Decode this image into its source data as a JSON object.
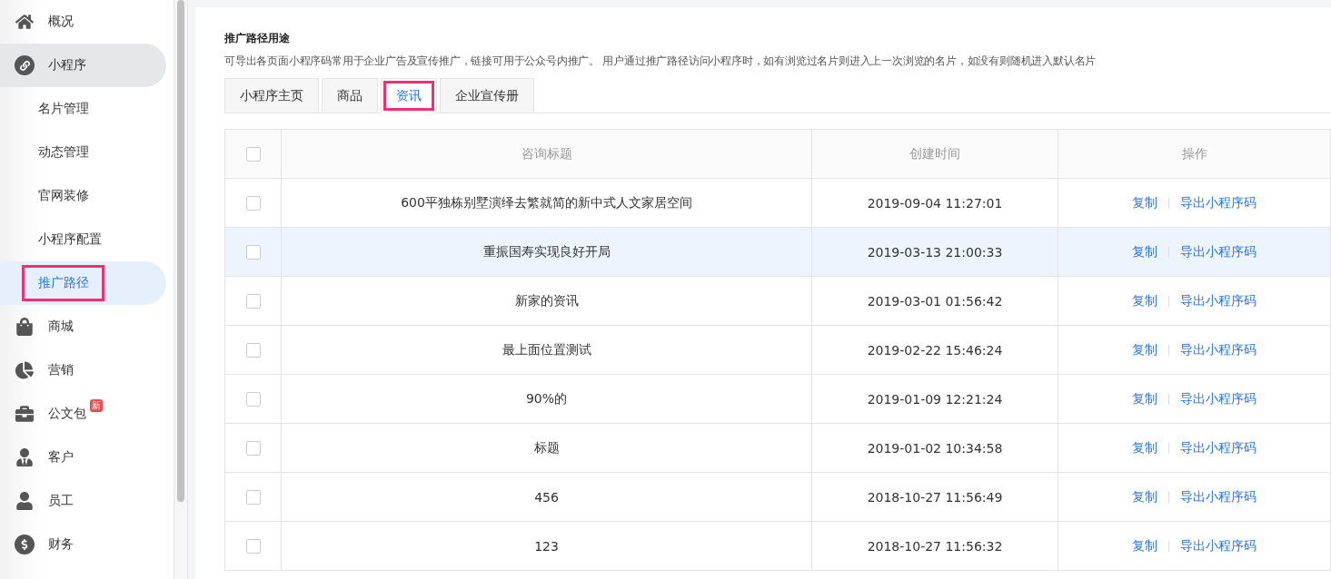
{
  "sidebar": {
    "items": [
      {
        "label": "概况",
        "kind": "home",
        "expanded": false,
        "selected": false,
        "highlighted": false
      },
      {
        "label": "小程序",
        "kind": "mini",
        "expanded": true,
        "selected": false,
        "highlighted": false,
        "children": [
          {
            "label": "名片管理",
            "selected": false,
            "highlighted": false
          },
          {
            "label": "动态管理",
            "selected": false,
            "highlighted": false
          },
          {
            "label": "官网装修",
            "selected": false,
            "highlighted": false
          },
          {
            "label": "小程序配置",
            "selected": false,
            "highlighted": false
          },
          {
            "label": "推广路径",
            "selected": true,
            "highlighted": true
          }
        ]
      },
      {
        "label": "商城",
        "kind": "bag",
        "expanded": false,
        "selected": false,
        "highlighted": false
      },
      {
        "label": "营销",
        "kind": "pie",
        "expanded": false,
        "selected": false,
        "highlighted": false
      },
      {
        "label": "公文包",
        "kind": "briefcase",
        "expanded": false,
        "selected": false,
        "highlighted": false,
        "badge": "新"
      },
      {
        "label": "客户",
        "kind": "client",
        "expanded": false,
        "selected": false,
        "highlighted": false
      },
      {
        "label": "员工",
        "kind": "user",
        "expanded": false,
        "selected": false,
        "highlighted": false
      },
      {
        "label": "财务",
        "kind": "dollar",
        "expanded": false,
        "selected": false,
        "highlighted": false
      }
    ]
  },
  "section": {
    "title": "推广路径用途",
    "description": "可导出各页面小程序码常用于企业广告及宣传推广，链接可用于公众号内推广。 用户通过推广路径访问小程序时，如有浏览过名片则进入上一次浏览的名片，如没有则随机进入默认名片"
  },
  "tabs": [
    {
      "label": "小程序主页",
      "selected": false,
      "highlighted": false
    },
    {
      "label": "商品",
      "selected": false,
      "highlighted": false
    },
    {
      "label": "资讯",
      "selected": true,
      "highlighted": true
    },
    {
      "label": "企业宣传册",
      "selected": false,
      "highlighted": false
    }
  ],
  "table": {
    "select_all": {
      "checked": false
    },
    "columns": [
      "咨询标题",
      "创建时间",
      "操作"
    ],
    "rows": [
      {
        "checked": false,
        "hovered": false,
        "title": "600平独栋别墅演绎去繁就简的新中式人文家居空间",
        "created": "2019-09-04 11:27:01",
        "actions": [
          "复制",
          "导出小程序码"
        ]
      },
      {
        "checked": false,
        "hovered": true,
        "title": "重振国寿实现良好开局",
        "created": "2019-03-13 21:00:33",
        "actions": [
          "复制",
          "导出小程序码"
        ]
      },
      {
        "checked": false,
        "hovered": false,
        "title": "新家的资讯",
        "created": "2019-03-01 01:56:42",
        "actions": [
          "复制",
          "导出小程序码"
        ]
      },
      {
        "checked": false,
        "hovered": false,
        "title": "最上面位置测试",
        "created": "2019-02-22 15:46:24",
        "actions": [
          "复制",
          "导出小程序码"
        ]
      },
      {
        "checked": false,
        "hovered": false,
        "title": "90%的",
        "created": "2019-01-09 12:21:24",
        "actions": [
          "复制",
          "导出小程序码"
        ]
      },
      {
        "checked": false,
        "hovered": false,
        "title": "标题",
        "created": "2019-01-02 10:34:58",
        "actions": [
          "复制",
          "导出小程序码"
        ]
      },
      {
        "checked": false,
        "hovered": false,
        "title": "456",
        "created": "2018-10-27 11:56:49",
        "actions": [
          "复制",
          "导出小程序码"
        ]
      },
      {
        "checked": false,
        "hovered": false,
        "title": "123",
        "created": "2018-10-27 11:56:32",
        "actions": [
          "复制",
          "导出小程序码"
        ]
      }
    ]
  }
}
